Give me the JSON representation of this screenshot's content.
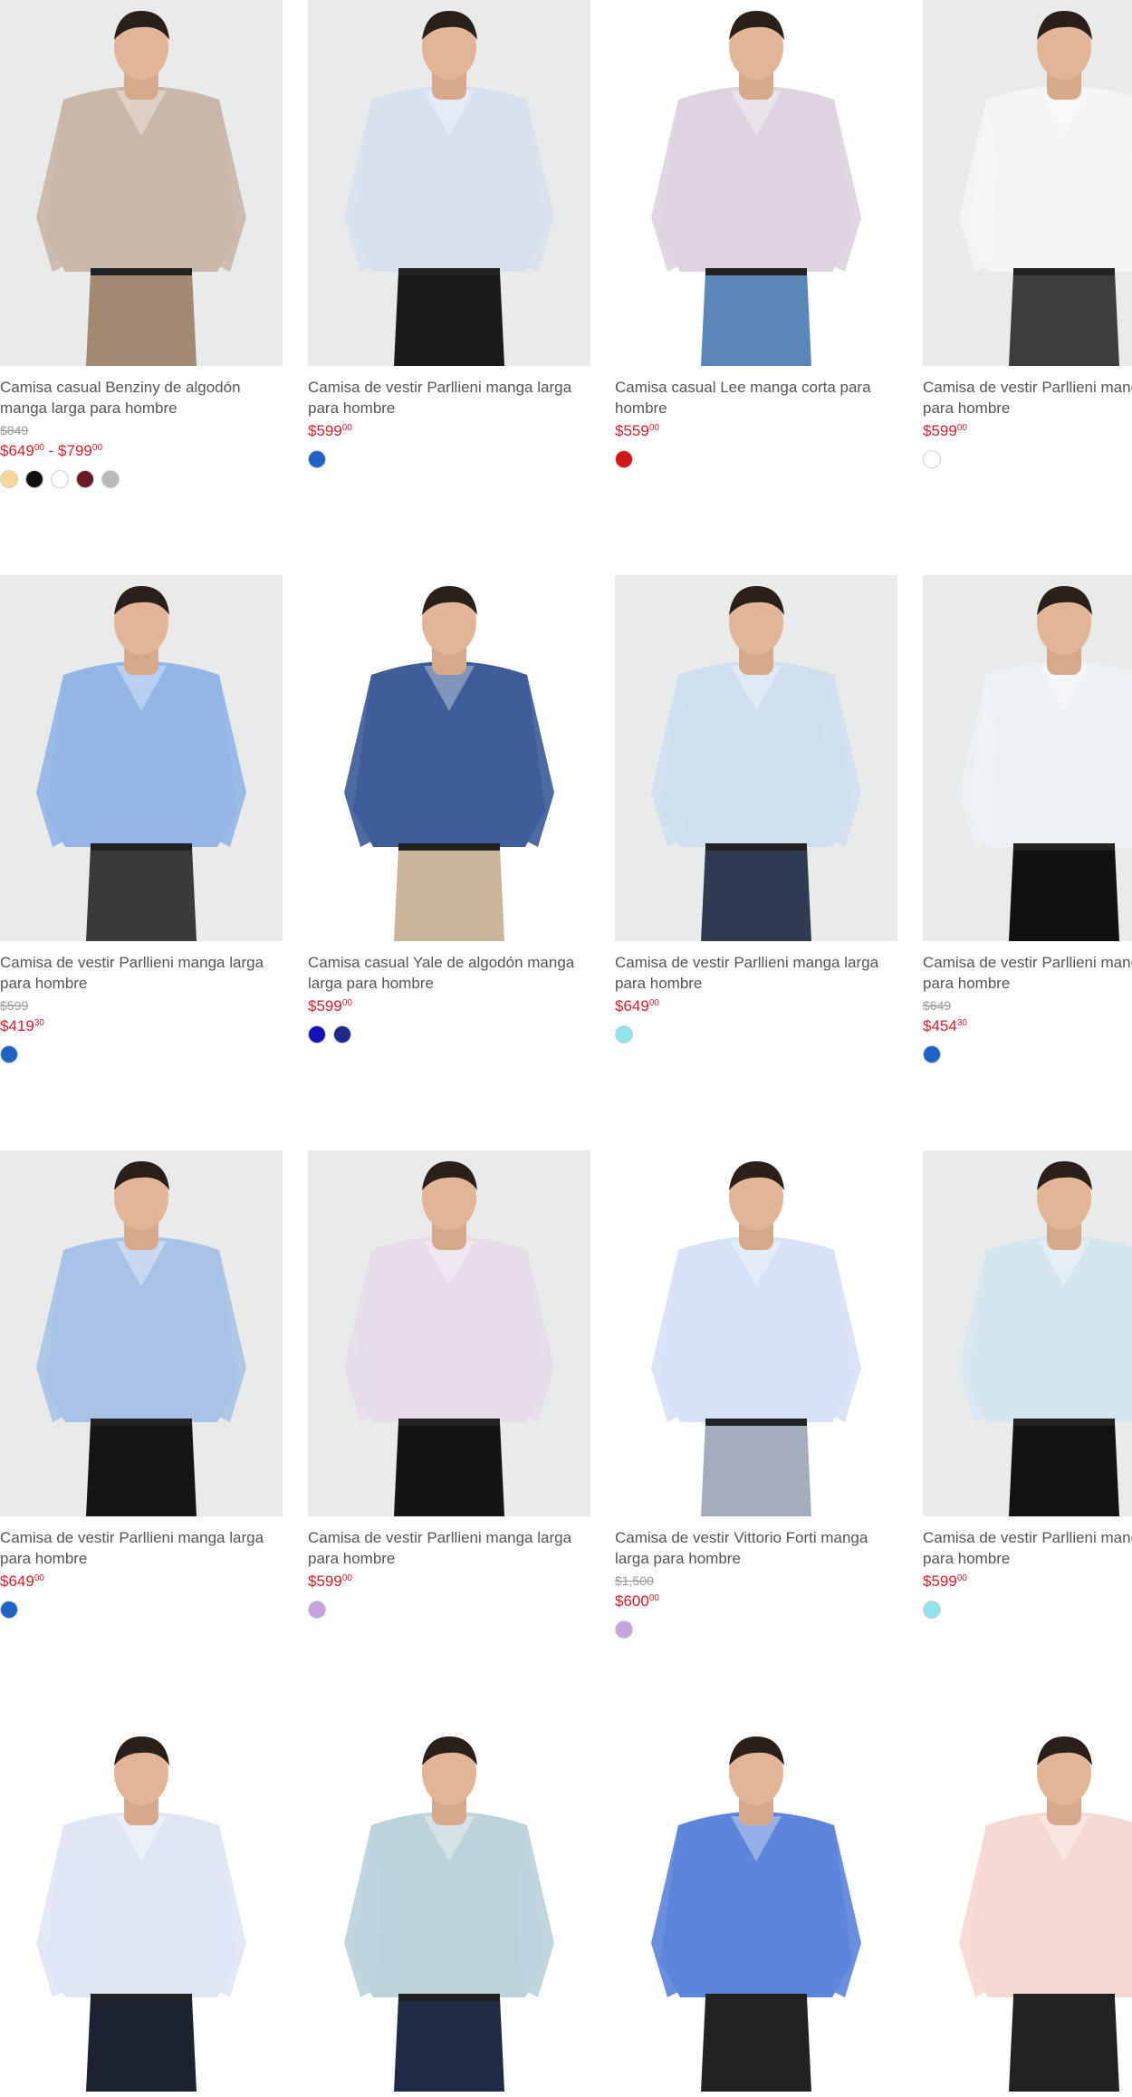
{
  "products": [
    {
      "title": "Camisa casual Benziny de algodón manga larga para hombre",
      "old_price": "$849",
      "price": "$649",
      "price_cents": "00",
      "price_to": " - $799",
      "price_to_cents": "00",
      "swatches": [
        "#f3d89a",
        "#111111",
        "#ffffff",
        "#6b1a24",
        "#b9b9b9"
      ],
      "shirt": "#c9b7a9",
      "pants": "#a08a72",
      "bg": "gray"
    },
    {
      "title": "Camisa de vestir Parllieni manga larga para hombre",
      "old_price": "",
      "price": "$599",
      "price_cents": "00",
      "swatches": [
        "#1f63c6"
      ],
      "shirt": "#d7e1ee",
      "pants": "#1a1a1a",
      "bg": "gray"
    },
    {
      "title": "Camisa casual Lee manga corta para hombre",
      "old_price": "",
      "price": "$559",
      "price_cents": "00",
      "swatches": [
        "#d01818"
      ],
      "shirt": "#ddd4df",
      "pants": "#5a86b8",
      "bg": "white"
    },
    {
      "title": "Camisa de vestir Parllieni manga larga para hombre",
      "old_price": "",
      "price": "$599",
      "price_cents": "00",
      "swatches": [
        "#ffffff"
      ],
      "shirt": "#f4f5f6",
      "pants": "#3d3d3d",
      "bg": "gray"
    },
    {
      "title": "Camisa de vestir Parllieni manga larga para hombre",
      "old_price": "$599",
      "price": "$419",
      "price_cents": "30",
      "swatches": [
        "#1f63c6"
      ],
      "shirt": "#93b6e6",
      "pants": "#3a3a3a",
      "bg": "gray"
    },
    {
      "title": "Camisa casual Yale de algodón manga larga para hombre",
      "old_price": "",
      "price": "$599",
      "price_cents": "00",
      "swatches": [
        "#1212b8",
        "#1c2a8a"
      ],
      "shirt": "#3e5d99",
      "pants": "#c9b59a",
      "bg": "white"
    },
    {
      "title": "Camisa de vestir Parllieni manga larga para hombre",
      "old_price": "",
      "price": "$649",
      "price_cents": "00",
      "swatches": [
        "#8fe3ea"
      ],
      "shirt": "#cfdff0",
      "pants": "#2e3b50",
      "bg": "gray"
    },
    {
      "title": "Camisa de vestir Parllieni manga larga para hombre",
      "old_price": "$649",
      "price": "$454",
      "price_cents": "30",
      "swatches": [
        "#1f63c6"
      ],
      "shirt": "#eef1f4",
      "pants": "#111111",
      "bg": "gray"
    },
    {
      "title": "Camisa de vestir Parllieni manga larga para hombre",
      "old_price": "",
      "price": "$649",
      "price_cents": "00",
      "swatches": [
        "#1f63c6"
      ],
      "shirt": "#a9c3e6",
      "pants": "#151515",
      "bg": "gray"
    },
    {
      "title": "Camisa de vestir Parllieni manga larga para hombre",
      "old_price": "",
      "price": "$599",
      "price_cents": "00",
      "swatches": [
        "#c8a2dc"
      ],
      "shirt": "#e6dcea",
      "pants": "#141414",
      "bg": "gray"
    },
    {
      "title": "Camisa de vestir Vittorio Forti manga larga para hombre",
      "old_price": "$1,500",
      "price": "$600",
      "price_cents": "00",
      "swatches": [
        "#c8a2dc"
      ],
      "shirt": "#d8e2f6",
      "pants": "#a3adbb",
      "bg": "white"
    },
    {
      "title": "Camisa de vestir Parllieni manga larga para hombre",
      "old_price": "",
      "price": "$599",
      "price_cents": "00",
      "swatches": [
        "#8fe3ea"
      ],
      "shirt": "#d6e6f0",
      "pants": "#121212",
      "bg": "gray"
    },
    {
      "title": "",
      "old_price": "",
      "price": "",
      "price_cents": "",
      "swatches": [],
      "shirt": "#dfe6f4",
      "pants": "#1d2230",
      "bg": "white"
    },
    {
      "title": "",
      "old_price": "",
      "price": "",
      "price_cents": "",
      "swatches": [],
      "shirt": "#bdd3dc",
      "pants": "#1f2b44",
      "bg": "white"
    },
    {
      "title": "",
      "old_price": "",
      "price": "",
      "price_cents": "",
      "swatches": [],
      "shirt": "#5d86da",
      "pants": "#222222",
      "bg": "white"
    },
    {
      "title": "",
      "old_price": "",
      "price": "",
      "price_cents": "",
      "swatches": [],
      "shirt": "#f6d9d2",
      "pants": "#222222",
      "bg": "white"
    }
  ]
}
